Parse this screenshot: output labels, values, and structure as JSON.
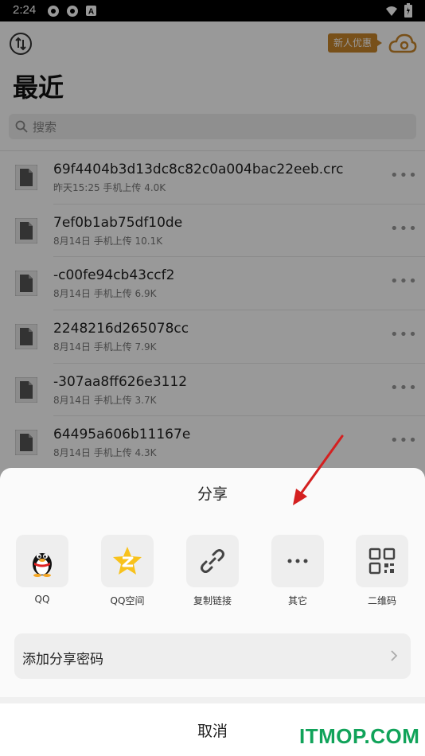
{
  "status_bar": {
    "time": "2:24"
  },
  "header": {
    "promo_label": "新人优惠",
    "title": "最近"
  },
  "search": {
    "placeholder": "搜索"
  },
  "files": [
    {
      "name": "69f4404b3d13dc8c82c0a004bac22eeb.crc",
      "meta": "昨天15:25  手机上传  4.0K"
    },
    {
      "name": "7ef0b1ab75df10de",
      "meta": "8月14日  手机上传  10.1K"
    },
    {
      "name": "-c00fe94cb43ccf2",
      "meta": "8月14日  手机上传  6.9K"
    },
    {
      "name": "2248216d265078cc",
      "meta": "8月14日  手机上传  7.9K"
    },
    {
      "name": "-307aa8ff626e3112",
      "meta": "8月14日  手机上传  3.7K"
    },
    {
      "name": "64495a606b11167e",
      "meta": "8月14日  手机上传  4.3K"
    }
  ],
  "share_sheet": {
    "title": "分享",
    "targets": [
      {
        "label": "QQ",
        "icon": "qq-penguin-icon"
      },
      {
        "label": "QQ空间",
        "icon": "qzone-star-icon"
      },
      {
        "label": "复制链接",
        "icon": "link-icon"
      },
      {
        "label": "其它",
        "icon": "more-dots-icon"
      },
      {
        "label": "二维码",
        "icon": "qr-code-icon"
      }
    ],
    "password_label": "添加分享密码",
    "cancel_label": "取消"
  },
  "watermark": "ITMOP.COM",
  "colors": {
    "promo": "#c9852a",
    "annotation_arrow": "#d42020",
    "watermark": "#11a35a"
  }
}
